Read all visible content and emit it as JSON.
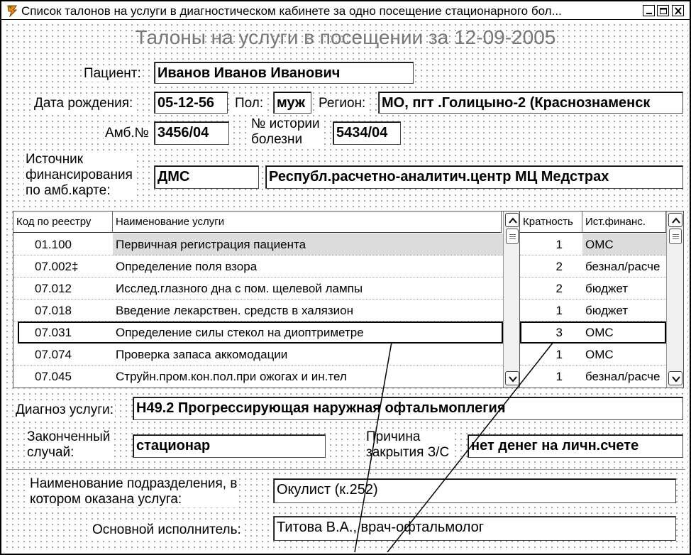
{
  "window": {
    "title": "Список талонов на услуги в диагностическом кабинете за одно посещение стационарного бол..."
  },
  "page_title": "Талоны на услуги в посещении за 12-09-2005",
  "patient": {
    "patient_label": "Пациент:",
    "patient_name": "Иванов Иванов Иванович",
    "birth_label": "Дата рождения:",
    "birth_date": "05-12-56",
    "sex_label": "Пол:",
    "sex": "муж",
    "region_label": "Регион:",
    "region": "МО, пгт .Голицыно-2 (Краснознаменск",
    "amb_label": "Амб.№",
    "amb_number": "3456/04",
    "history_label_1": "№ истории",
    "history_label_2": "болезни",
    "history_number": "5434/04",
    "finance_label_1": "Источник",
    "finance_label_2": "финансирования",
    "finance_label_3": "по амб.карте:",
    "finance_source": "ДМС",
    "finance_org": "Республ.расчетно-аналитич.центр МЦ Медстрах"
  },
  "services_grid": {
    "col_code": "Код по реестру",
    "col_name": "Наименование услуги",
    "col_mult": "Кратность",
    "col_fin": "Ист.финанс.",
    "rows": [
      {
        "code": "01.100",
        "name": "Первичная регистрация пациента",
        "mult": "1",
        "fin": "ОМС"
      },
      {
        "code": "07.002‡",
        "name": "Определение поля взора",
        "mult": "2",
        "fin": "безнал/расче"
      },
      {
        "code": "07.012",
        "name": "Исслед.глазного дна с пом. щелевой лампы",
        "mult": "2",
        "fin": "бюджет"
      },
      {
        "code": "07.018",
        "name": "Введение лекарствен. средств в халязион",
        "mult": "1",
        "fin": "бюджет"
      },
      {
        "code": "07.031",
        "name": "Определение силы стекол на диоптриметре",
        "mult": "3",
        "fin": "ОМС"
      },
      {
        "code": "07.074",
        "name": "Проверка запаса аккомодации",
        "mult": "1",
        "fin": "ОМС"
      },
      {
        "code": "07.045",
        "name": "Струйн.пром.кон.пол.при ожогах и ин.тел",
        "mult": "1",
        "fin": "безнал/расче"
      }
    ]
  },
  "diagnosis": {
    "label": "Диагноз услуги:",
    "value": "H49.2 Прогрессирующая наружная офтальмоплегия"
  },
  "case": {
    "finished_label_1": "Законченный",
    "finished_label_2": "случай:",
    "finished_value": "стационар",
    "reason_label_1": "Причина",
    "reason_label_2": "закрытия З/С",
    "reason_value": "нет денег на личн.счете"
  },
  "department": {
    "label_1": "Наименование подразделения, в",
    "label_2": "котором оказана услуга:",
    "value": "Окулист (к.252)",
    "executor_label": "Основной исполнитель:",
    "executor_value": "Титова В.А., врач-офтальмолог"
  }
}
